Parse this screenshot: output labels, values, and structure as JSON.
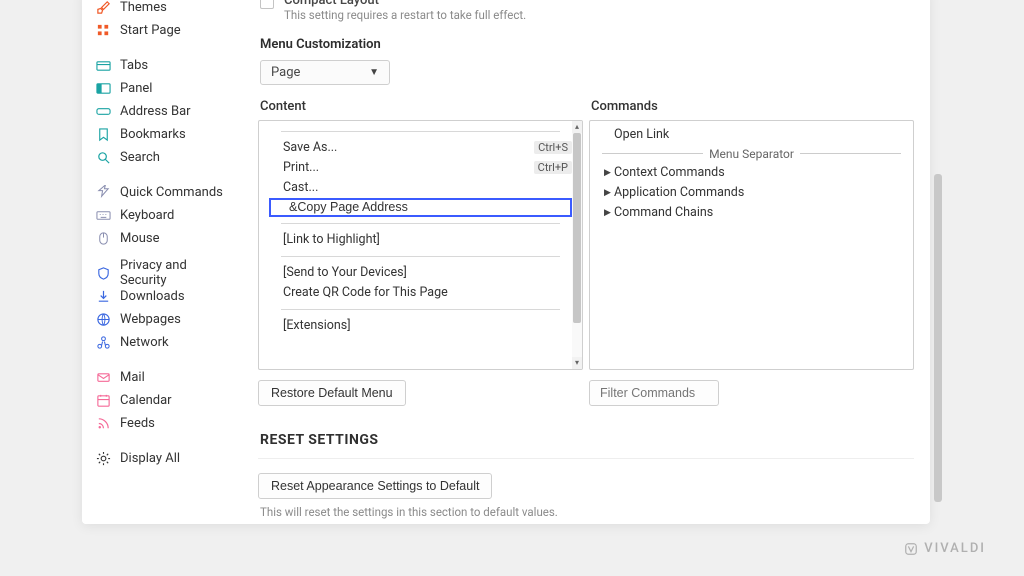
{
  "sidebar": {
    "g1": [
      {
        "icon": "brush",
        "label": "Themes",
        "color": "#f05a28"
      },
      {
        "icon": "grid",
        "label": "Start Page",
        "color": "#f05a28"
      }
    ],
    "g2": [
      {
        "icon": "tabs",
        "label": "Tabs",
        "color": "#1aa3a3"
      },
      {
        "icon": "panel",
        "label": "Panel",
        "color": "#1aa3a3"
      },
      {
        "icon": "addressbar",
        "label": "Address Bar",
        "color": "#1aa3a3"
      },
      {
        "icon": "bookmark",
        "label": "Bookmarks",
        "color": "#1aa3a3"
      },
      {
        "icon": "search",
        "label": "Search",
        "color": "#1aa3a3"
      }
    ],
    "g3": [
      {
        "icon": "bolt",
        "label": "Quick Commands",
        "color": "#8a8fb0"
      },
      {
        "icon": "keyboard",
        "label": "Keyboard",
        "color": "#8a8fb0"
      },
      {
        "icon": "mouse",
        "label": "Mouse",
        "color": "#8a8fb0"
      }
    ],
    "g4": [
      {
        "icon": "shield",
        "label": "Privacy and Security",
        "color": "#3a67e0"
      },
      {
        "icon": "download",
        "label": "Downloads",
        "color": "#3a67e0"
      },
      {
        "icon": "globe",
        "label": "Webpages",
        "color": "#3a67e0"
      },
      {
        "icon": "network",
        "label": "Network",
        "color": "#3a67e0"
      }
    ],
    "g5": [
      {
        "icon": "mail",
        "label": "Mail",
        "color": "#f56a98"
      },
      {
        "icon": "calendar",
        "label": "Calendar",
        "color": "#f56a98"
      },
      {
        "icon": "rss",
        "label": "Feeds",
        "color": "#f56a98"
      }
    ],
    "g6": [
      {
        "icon": "gear",
        "label": "Display All",
        "color": "#333"
      }
    ]
  },
  "compact": {
    "title": "Compact Layout",
    "sub": "This setting requires a restart to take full effect."
  },
  "menuCustomization": {
    "label": "Menu Customization",
    "dropdown_value": "Page",
    "content_label": "Content",
    "commands_label": "Commands",
    "restore_label": "Restore Default Menu",
    "filter_placeholder": "Filter Commands"
  },
  "content_items": {
    "save": {
      "label": "Save As...",
      "shortcut": "Ctrl+S"
    },
    "print": {
      "label": "Print...",
      "shortcut": "Ctrl+P"
    },
    "cast": "Cast...",
    "edit_value": "&Copy Page Address",
    "link_highlight": "[Link to Highlight]",
    "send_devices": "[Send to Your Devices]",
    "qr": "Create QR Code for This Page",
    "extensions": "[Extensions]"
  },
  "commands": {
    "open_link": "Open Link",
    "separator": "Menu Separator",
    "context": "Context Commands",
    "application": "Application Commands",
    "chains": "Command Chains"
  },
  "reset": {
    "heading": "RESET SETTINGS",
    "button": "Reset Appearance Settings to Default",
    "sub": "This will reset the settings in this section to default values."
  },
  "brand": "VIVALDI"
}
